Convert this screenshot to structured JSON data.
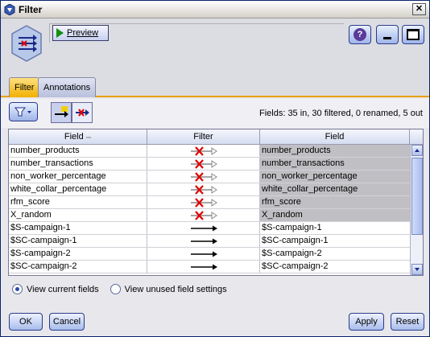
{
  "window": {
    "title": "Filter"
  },
  "toolbar": {
    "preview_label": "Preview"
  },
  "tabs": [
    {
      "label": "Filter",
      "active": true
    },
    {
      "label": "Annotations",
      "active": false
    }
  ],
  "fields_summary": "Fields: 35 in, 30 filtered, 0 renamed, 5 out",
  "table": {
    "headers": [
      "Field",
      "Filter",
      "Field"
    ],
    "sort_indicator": "⎓",
    "rows": [
      {
        "field": "number_products",
        "filter": "removed",
        "out": "number_products"
      },
      {
        "field": "number_transactions",
        "filter": "removed",
        "out": "number_transactions"
      },
      {
        "field": "non_worker_percentage",
        "filter": "removed",
        "out": "non_worker_percentage"
      },
      {
        "field": "white_collar_percentage",
        "filter": "removed",
        "out": "white_collar_percentage"
      },
      {
        "field": "rfm_score",
        "filter": "removed",
        "out": "rfm_score"
      },
      {
        "field": "X_random",
        "filter": "removed",
        "out": "X_random"
      },
      {
        "field": "$S-campaign-1",
        "filter": "pass",
        "out": "$S-campaign-1"
      },
      {
        "field": "$SC-campaign-1",
        "filter": "pass",
        "out": "$SC-campaign-1"
      },
      {
        "field": "$S-campaign-2",
        "filter": "pass",
        "out": "$S-campaign-2"
      },
      {
        "field": "$SC-campaign-2",
        "filter": "pass",
        "out": "$SC-campaign-2"
      }
    ]
  },
  "view_options": {
    "current": "View current fields",
    "unused": "View unused field settings",
    "selected": "current"
  },
  "buttons": {
    "ok": "OK",
    "cancel": "Cancel",
    "apply": "Apply",
    "reset": "Reset"
  },
  "colors": {
    "accent": "#f0b000",
    "filtered_cell": "#c0c0c4",
    "remove_x": "#e00000"
  }
}
